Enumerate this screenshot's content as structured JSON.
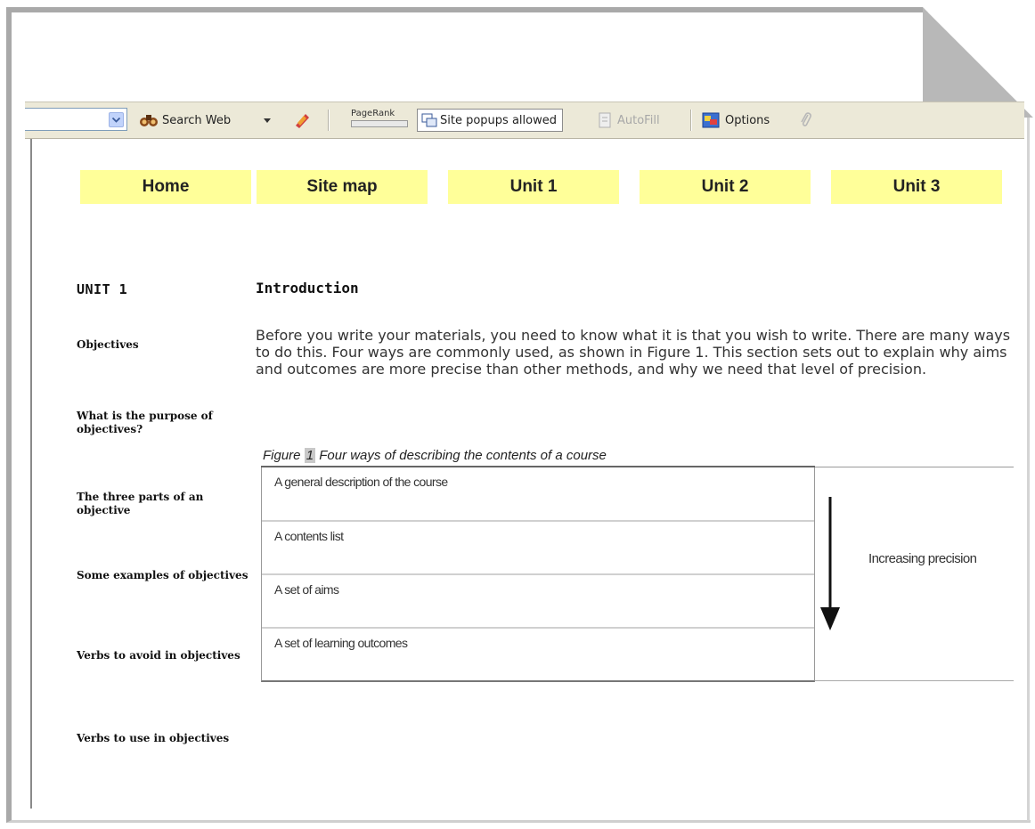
{
  "toolbar": {
    "search_web": "Search Web",
    "pagerank": "PageRank",
    "popups": "Site popups allowed",
    "autofill": "AutoFill",
    "options": "Options"
  },
  "nav": [
    {
      "label": "Home"
    },
    {
      "label": "Site map"
    },
    {
      "label": "Unit 1"
    },
    {
      "label": "Unit 2"
    },
    {
      "label": "Unit 3"
    }
  ],
  "sidebar": {
    "heading": "UNIT 1",
    "links": [
      {
        "label": "Objectives"
      },
      {
        "label": "What is the purpose of objectives?"
      },
      {
        "label": "The three parts of an objective"
      },
      {
        "label": "Some examples of objectives"
      },
      {
        "label": "Verbs to avoid in objectives"
      },
      {
        "label": "Verbs to use in objectives"
      }
    ]
  },
  "main": {
    "title": "Introduction",
    "body": "Before you write your materials, you need to know what it is that you wish to write. There are many ways to do this. Four ways are commonly used, as shown in Figure 1. This section sets out to explain why aims and outcomes are more precise than other methods, and why we need that level of precision."
  },
  "figure": {
    "caption_prefix": "Figure",
    "caption_number": "1",
    "caption_text": "Four ways of describing the contents of a course",
    "rows": [
      "A general description of the course",
      "A contents list",
      "A set of aims",
      "A set of learning outcomes"
    ],
    "arrow_label": "Increasing precision"
  },
  "colors": {
    "nav_background": "#ffff99",
    "toolbar_background": "#ece9d8"
  }
}
